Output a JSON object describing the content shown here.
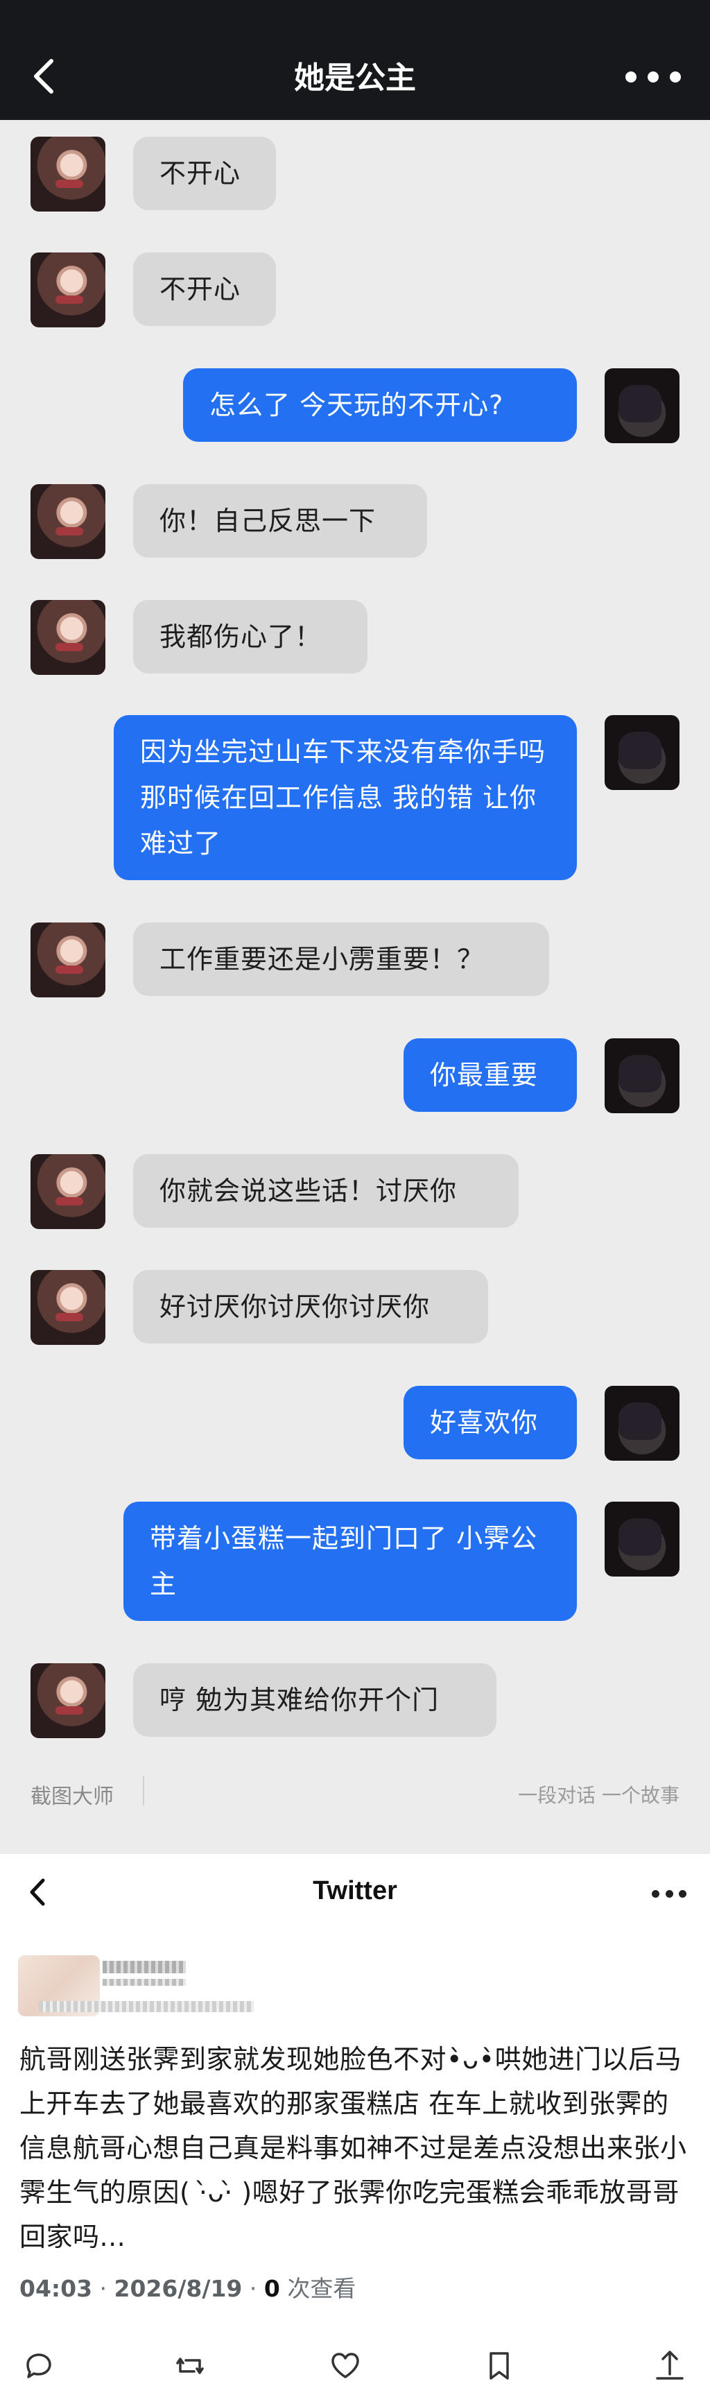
{
  "header": {
    "title": "她是公主"
  },
  "messages": [
    {
      "side": "in",
      "text": "不开心"
    },
    {
      "side": "in",
      "text": "不开心"
    },
    {
      "side": "out",
      "text": "怎么了 今天玩的不开心?"
    },
    {
      "side": "in",
      "text": "你！自己反思一下"
    },
    {
      "side": "in",
      "text": "我都伤心了！"
    },
    {
      "side": "out",
      "text": "因为坐完过山车下来没有牵你手吗 那时候在回工作信息 我的错 让你难过了"
    },
    {
      "side": "in",
      "text": "工作重要还是小雳重要！？"
    },
    {
      "side": "out",
      "text": "你最重要"
    },
    {
      "side": "in",
      "text": "你就会说这些话！讨厌你"
    },
    {
      "side": "in",
      "text": "好讨厌你讨厌你讨厌你"
    },
    {
      "side": "out",
      "text": "好喜欢你"
    },
    {
      "side": "out",
      "text": "带着小蛋糕一起到门口了 小霁公主"
    },
    {
      "side": "in",
      "text": "哼 勉为其难给你开个门"
    }
  ],
  "chat_footer": {
    "brand": "截图大师",
    "slogan": "一段对话 一个故事"
  },
  "twitter": {
    "title": "Twitter",
    "text": "航哥刚送张霁到家就发现她脸色不对•̀ᴗ•̀哄她进门以后马上开车去了她最喜欢的那家蛋糕店 在车上就收到张霁的信息航哥心想自己真是料事如神不过是差点没想出来张小霁生气的原因( ·̀ᴗ·̀ )嗯好了张霁你吃完蛋糕会乖乖放哥哥回家吗...",
    "time": "04:03",
    "date": "2026/8/19",
    "views_count": "0",
    "views_label": "次查看",
    "actions": [
      "reply-icon",
      "retweet-icon",
      "like-icon",
      "bookmark-icon",
      "share-icon"
    ]
  }
}
